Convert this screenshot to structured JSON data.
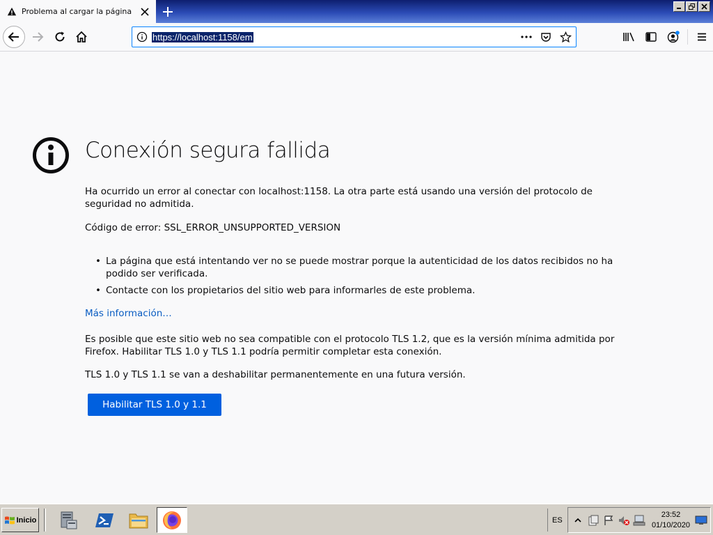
{
  "browser": {
    "tab_title": "Problema al cargar la página",
    "url": "https://localhost:1158/em"
  },
  "error_page": {
    "title": "Conexión segura fallida",
    "description": "Ha ocurrido un error al conectar con localhost:1158. La otra parte está usando una versión del protocolo de seguridad no admitida.",
    "error_code": "Código de error: SSL_ERROR_UNSUPPORTED_VERSION",
    "reasons": [
      "La página que está intentando ver no se puede mostrar porque la autenticidad de los datos recibidos no ha podido ser verificada.",
      "Contacte con los propietarios del sitio web para informarles de este problema."
    ],
    "learn_more": "Más información…",
    "tls_note": "Es posible que este sitio web no sea compatible con el protocolo TLS 1.2, que es la versión mínima admitida por Firefox. Habilitar TLS 1.0 y TLS 1.1 podría permitir completar esta conexión.",
    "tls_deprecation": "TLS 1.0 y TLS 1.1 se van a deshabilitar permanentemente en una futura versión.",
    "enable_tls_button": "Habilitar TLS 1.0 y 1.1"
  },
  "taskbar": {
    "start_label": "Inicio",
    "language": "ES",
    "time": "23:52",
    "date": "01/10/2020",
    "apps": [
      "server-manager-icon",
      "powershell-icon",
      "file-explorer-icon",
      "firefox-icon"
    ]
  },
  "colors": {
    "accent": "#0060df",
    "link": "#0a5dc2",
    "url_border": "#0a84ff"
  }
}
